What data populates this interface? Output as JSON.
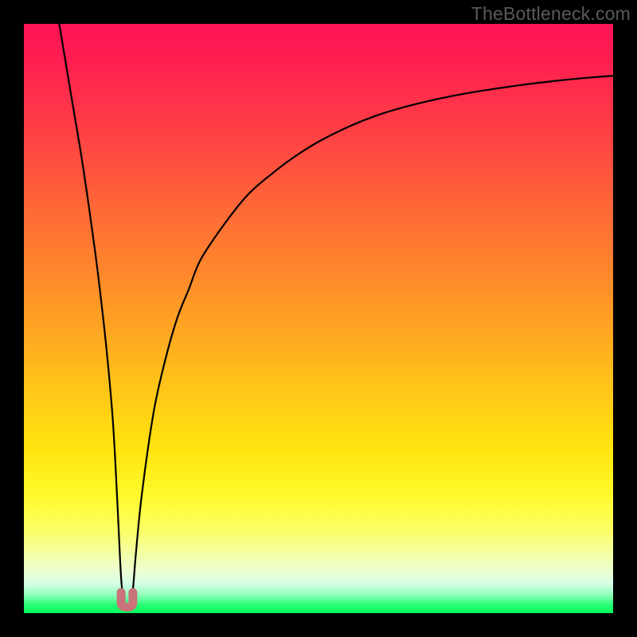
{
  "watermark": "TheBottleneck.com",
  "chart_data": {
    "type": "line",
    "title": "",
    "xlabel": "",
    "ylabel": "",
    "xlim": [
      0,
      100
    ],
    "ylim": [
      0,
      100
    ],
    "grid": false,
    "series": [
      {
        "name": "bottleneck-curve",
        "color": "#000000",
        "x": [
          6,
          8,
          10,
          12,
          13,
          14,
          15,
          15.5,
          16,
          16.5,
          17,
          17.5,
          18,
          18.5,
          19,
          20,
          22,
          24,
          26,
          28,
          30,
          34,
          38,
          42,
          46,
          50,
          55,
          60,
          65,
          70,
          75,
          80,
          85,
          90,
          95,
          100
        ],
        "values": [
          100,
          88,
          76,
          62,
          54,
          45,
          34,
          26,
          16,
          6,
          1.5,
          1.0,
          1.5,
          4,
          10,
          20,
          34,
          43,
          50,
          55,
          60,
          66,
          71,
          74.5,
          77.5,
          80,
          82.5,
          84.5,
          86,
          87.2,
          88.2,
          89,
          89.7,
          90.3,
          90.8,
          91.2
        ]
      }
    ],
    "annotations": [
      {
        "name": "valley-marker",
        "type": "marker",
        "shape": "u",
        "color": "#c9737a",
        "x_range": [
          16.5,
          18.5
        ],
        "y": 1.0
      }
    ]
  }
}
